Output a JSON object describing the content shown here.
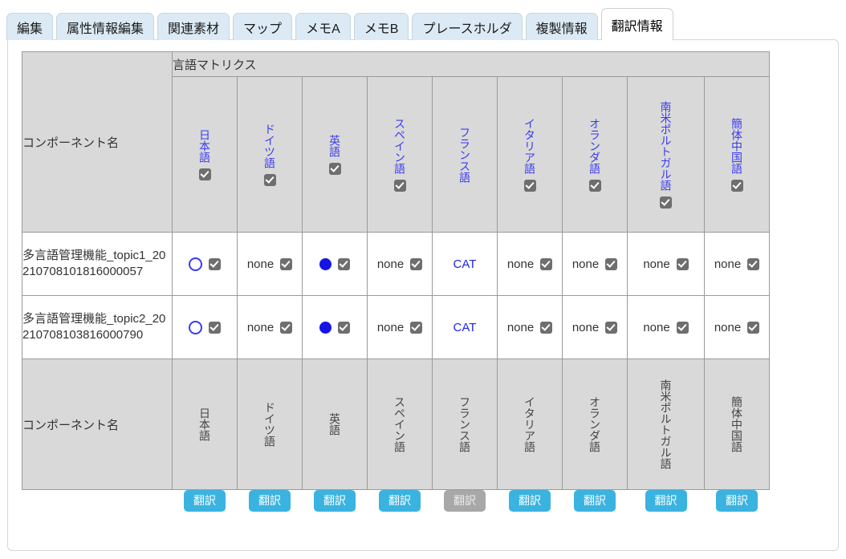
{
  "tabs": [
    {
      "label": "編集",
      "active": false
    },
    {
      "label": "属性情報編集",
      "active": false
    },
    {
      "label": "関連素材",
      "active": false
    },
    {
      "label": "マップ",
      "active": false
    },
    {
      "label": "メモA",
      "active": false
    },
    {
      "label": "メモB",
      "active": false
    },
    {
      "label": "プレースホルダ",
      "active": false
    },
    {
      "label": "複製情報",
      "active": false
    },
    {
      "label": "翻訳情報",
      "active": true
    }
  ],
  "table": {
    "component_name_header": "コンポーネント名",
    "matrix_group_label": "言語マトリクス",
    "component_name_footer": "コンポーネント名",
    "languages": [
      {
        "name": "日本語",
        "header_checkbox": true
      },
      {
        "name": "ドイツ語",
        "header_checkbox": true
      },
      {
        "name": "英語",
        "header_checkbox": true
      },
      {
        "name": "スペイン語",
        "header_checkbox": true
      },
      {
        "name": "フランス語",
        "header_checkbox": false
      },
      {
        "name": "イタリア語",
        "header_checkbox": true
      },
      {
        "name": "オランダ語",
        "header_checkbox": true
      },
      {
        "name": "南米ポルトガル語",
        "header_checkbox": true
      },
      {
        "name": "簡体中国語",
        "header_checkbox": true
      }
    ],
    "rows": [
      {
        "name": "多言語管理機能_topic1_20210708101816000057",
        "cells": [
          {
            "mark": "circle-open",
            "text": "",
            "checkbox": true
          },
          {
            "mark": "none",
            "text": "none",
            "checkbox": true
          },
          {
            "mark": "circle-filled",
            "text": "",
            "checkbox": true
          },
          {
            "mark": "none",
            "text": "none",
            "checkbox": true
          },
          {
            "mark": "cat",
            "text": "CAT",
            "checkbox": false
          },
          {
            "mark": "none",
            "text": "none",
            "checkbox": true
          },
          {
            "mark": "none",
            "text": "none",
            "checkbox": true
          },
          {
            "mark": "none",
            "text": "none",
            "checkbox": true
          },
          {
            "mark": "none",
            "text": "none",
            "checkbox": true
          }
        ]
      },
      {
        "name": "多言語管理機能_topic2_20210708103816000790",
        "cells": [
          {
            "mark": "circle-open",
            "text": "",
            "checkbox": true
          },
          {
            "mark": "none",
            "text": "none",
            "checkbox": true
          },
          {
            "mark": "circle-filled",
            "text": "",
            "checkbox": true
          },
          {
            "mark": "none",
            "text": "none",
            "checkbox": true
          },
          {
            "mark": "cat",
            "text": "CAT",
            "checkbox": false
          },
          {
            "mark": "none",
            "text": "none",
            "checkbox": true
          },
          {
            "mark": "none",
            "text": "none",
            "checkbox": true
          },
          {
            "mark": "none",
            "text": "none",
            "checkbox": true
          },
          {
            "mark": "none",
            "text": "none",
            "checkbox": true
          }
        ]
      }
    ],
    "translate_buttons": [
      {
        "label": "翻訳",
        "disabled": false
      },
      {
        "label": "翻訳",
        "disabled": false
      },
      {
        "label": "翻訳",
        "disabled": false
      },
      {
        "label": "翻訳",
        "disabled": false
      },
      {
        "label": "翻訳",
        "disabled": true
      },
      {
        "label": "翻訳",
        "disabled": false
      },
      {
        "label": "翻訳",
        "disabled": false
      },
      {
        "label": "翻訳",
        "disabled": false
      },
      {
        "label": "翻訳",
        "disabled": false
      }
    ]
  },
  "colors": {
    "tab_inactive_bg": "#dbeaf5",
    "tab_active_bg": "#ffffff",
    "header_bg": "#d9d9d9",
    "lang_text_blue": "#3b3bf0",
    "lang_text_grey": "#444444",
    "mark_blue": "#1414e6",
    "button_enabled": "#3bb3e0",
    "button_disabled": "#a8a8a8",
    "grid_line": "#9a9a9a"
  }
}
